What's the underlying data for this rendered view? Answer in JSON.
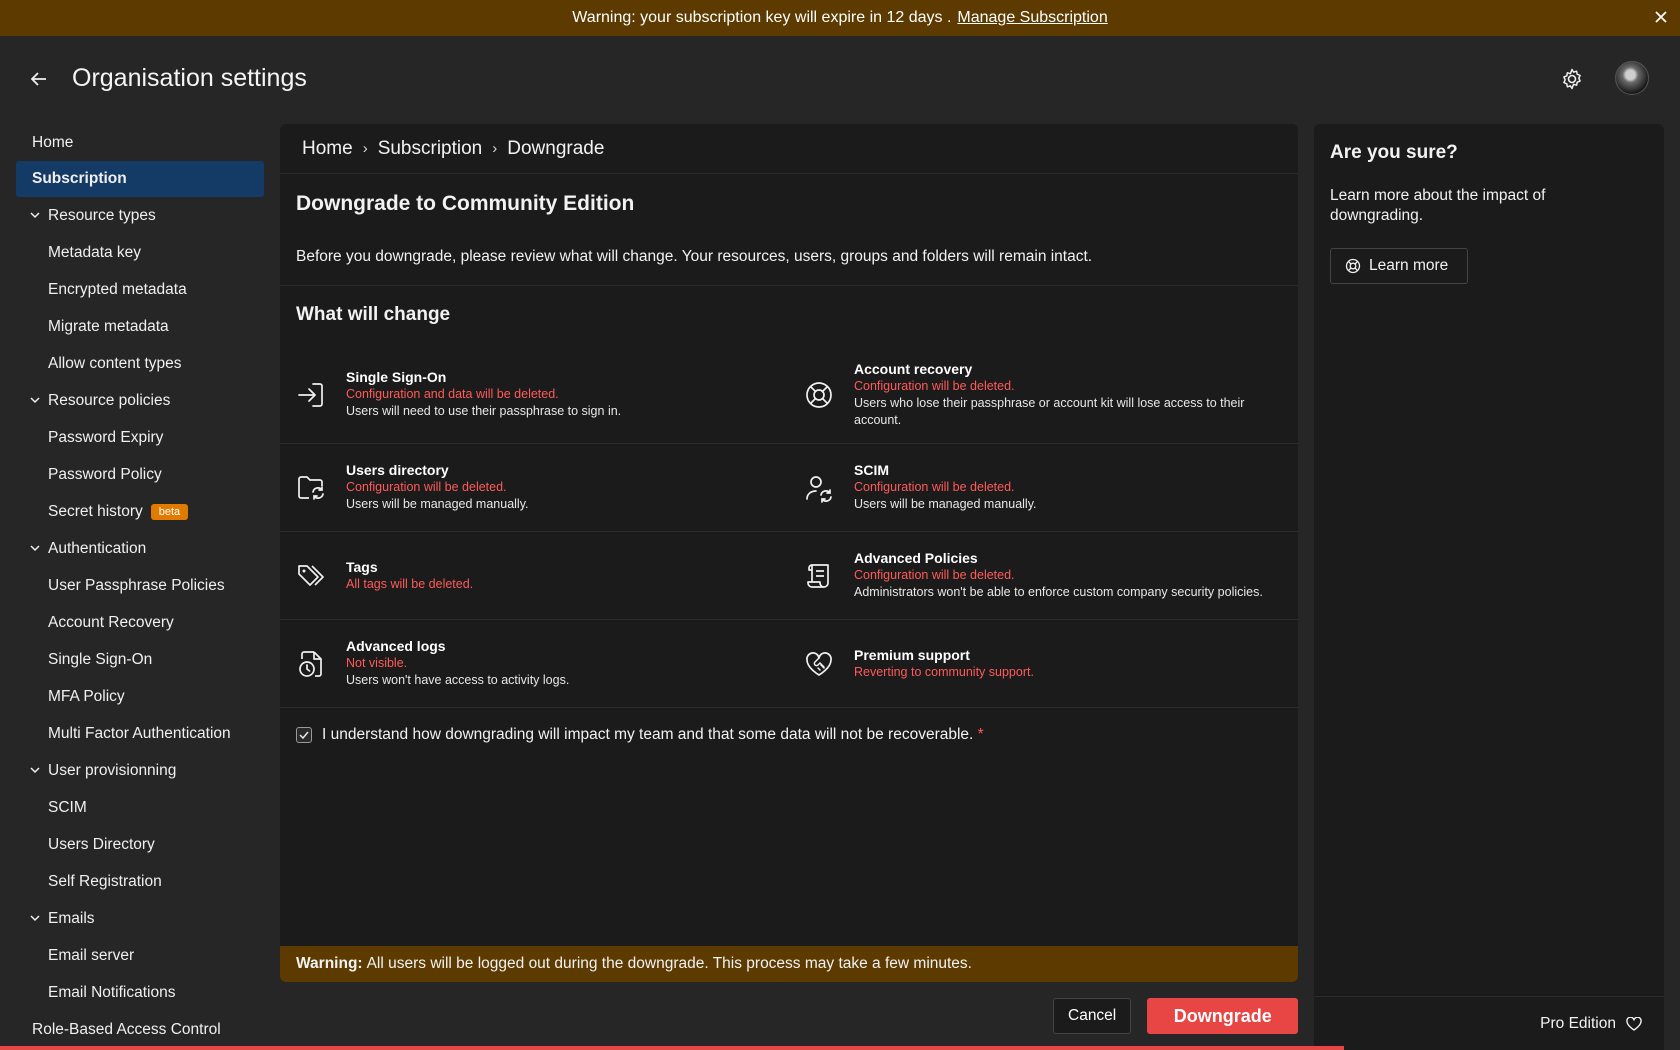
{
  "banner": {
    "text": "Warning: your subscription key will expire  in 12 days  .",
    "link": "Manage Subscription",
    "color": "#5c3a00"
  },
  "header": {
    "title": "Organisation settings"
  },
  "sidebar": {
    "items": [
      {
        "label": "Home",
        "kind": "top"
      },
      {
        "label": "Subscription",
        "kind": "top",
        "active": true
      },
      {
        "label": "Resource types",
        "kind": "group"
      },
      {
        "label": "Metadata key",
        "kind": "sub"
      },
      {
        "label": "Encrypted metadata",
        "kind": "sub"
      },
      {
        "label": "Migrate metadata",
        "kind": "sub"
      },
      {
        "label": "Allow content types",
        "kind": "sub"
      },
      {
        "label": "Resource policies",
        "kind": "group"
      },
      {
        "label": "Password Expiry",
        "kind": "sub"
      },
      {
        "label": "Password Policy",
        "kind": "sub"
      },
      {
        "label": "Secret history",
        "kind": "sub",
        "badge": "beta"
      },
      {
        "label": "Authentication",
        "kind": "group"
      },
      {
        "label": "User Passphrase Policies",
        "kind": "sub"
      },
      {
        "label": "Account Recovery",
        "kind": "sub"
      },
      {
        "label": "Single Sign-On",
        "kind": "sub"
      },
      {
        "label": "MFA Policy",
        "kind": "sub"
      },
      {
        "label": "Multi Factor Authentication",
        "kind": "sub"
      },
      {
        "label": "User provisionning",
        "kind": "group"
      },
      {
        "label": "SCIM",
        "kind": "sub"
      },
      {
        "label": "Users Directory",
        "kind": "sub"
      },
      {
        "label": "Self Registration",
        "kind": "sub"
      },
      {
        "label": "Emails",
        "kind": "group"
      },
      {
        "label": "Email server",
        "kind": "sub"
      },
      {
        "label": "Email Notifications",
        "kind": "sub"
      },
      {
        "label": "Role-Based Access Control",
        "kind": "top"
      }
    ]
  },
  "main": {
    "breadcrumb": [
      "Home",
      "Subscription",
      "Downgrade"
    ],
    "breadcrumb_sep": "›",
    "title": "Downgrade to Community Edition",
    "intro": "Before you downgrade, please review what will change. Your resources, users, groups and folders will remain intact.",
    "section_title": "What will change",
    "changes": [
      {
        "name": "Single Sign-On",
        "warn": "Configuration and data will be deleted.",
        "desc": "Users will need to use their passphrase to sign in.",
        "icon": "sign-in-icon"
      },
      {
        "name": "Account recovery",
        "warn": "Configuration will be deleted.",
        "desc": "Users who lose their passphrase or account kit will lose access to their account.",
        "icon": "lifebuoy-icon"
      },
      {
        "name": "Users directory",
        "warn": "Configuration will be deleted.",
        "desc": "Users will be managed manually.",
        "icon": "folder-sync-icon"
      },
      {
        "name": "SCIM",
        "warn": "Configuration will be deleted.",
        "desc": "Users will be managed manually.",
        "icon": "user-sync-icon"
      },
      {
        "name": "Tags",
        "warn": "All tags will be deleted.",
        "desc": "",
        "icon": "tags-icon"
      },
      {
        "name": "Advanced Policies",
        "warn": "Configuration will be deleted.",
        "desc": "Administrators won't be able to enforce custom company security policies.",
        "icon": "scroll-icon"
      },
      {
        "name": "Advanced logs",
        "warn": "Not visible.",
        "desc": "Users won't have access to activity logs.",
        "icon": "file-clock-icon"
      },
      {
        "name": "Premium support",
        "warn": "Reverting to community support.",
        "desc": "",
        "icon": "heart-handshake-icon"
      }
    ],
    "confirm_text": "I understand how downgrading will impact my team and that some data will not be recoverable.",
    "confirm_required": "*",
    "confirm_checked": true,
    "warning_label": "Warning:",
    "warning_text": "All users will be logged out during the downgrade. This process may take a few minutes.",
    "cancel_label": "Cancel",
    "downgrade_label": "Downgrade"
  },
  "side_panel": {
    "title": "Are you sure?",
    "text": "Learn more about the impact of downgrading.",
    "learn_more": "Learn more",
    "edition": "Pro Edition"
  },
  "colors": {
    "accent_active": "#143a66",
    "danger": "#e84545",
    "warning_text": "#ff5a5a",
    "warning_bg": "#5c3a00",
    "badge": "#e07b00"
  }
}
